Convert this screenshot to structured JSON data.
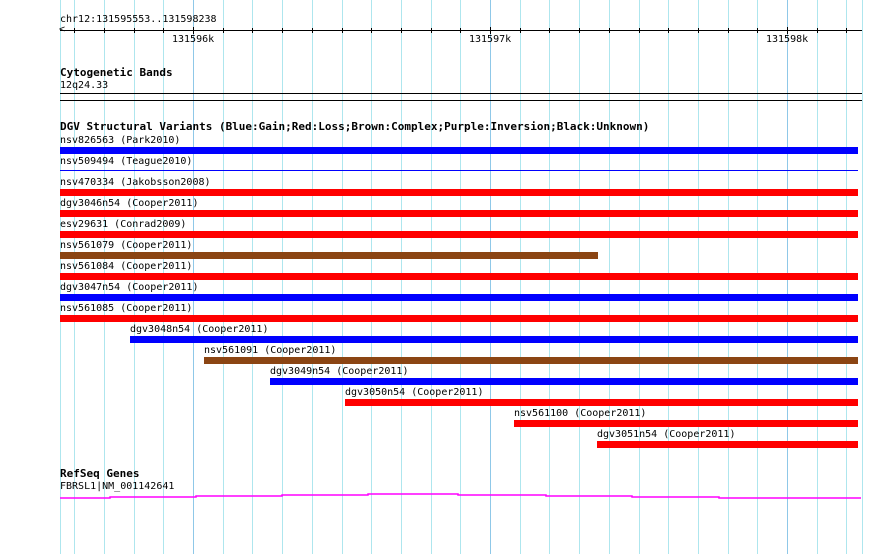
{
  "ruler": {
    "region": "chr12:131595553..131598238",
    "view_start": 131595553,
    "view_end": 131598238,
    "labels": [
      {
        "pos": 131596000,
        "text": "131596k"
      },
      {
        "pos": 131597000,
        "text": "131597k"
      },
      {
        "pos": 131598000,
        "text": "131598k"
      }
    ]
  },
  "cytobands": {
    "title": "Cytogenetic Bands",
    "band": "12q24.33"
  },
  "dgv": {
    "title": "DGV Structural Variants (Blue:Gain;Red:Loss;Brown:Complex;Purple:Inversion;Black:Unknown)",
    "colors": {
      "gain": "#0000ff",
      "loss": "#ff0000",
      "complex": "#8b4513"
    },
    "variants": [
      {
        "label": "nsv826563 (Park2010)",
        "start": 131595553,
        "end": 131598238,
        "type": "gain"
      },
      {
        "label": "nsv509494 (Teague2010)",
        "start": 131595553,
        "end": 131598238,
        "type": "gain",
        "thin": true
      },
      {
        "label": "nsv470334 (Jakobsson2008)",
        "start": 131595553,
        "end": 131598238,
        "type": "loss"
      },
      {
        "label": "dgv3046n54 (Cooper2011)",
        "start": 131595553,
        "end": 131598238,
        "type": "loss"
      },
      {
        "label": "esv29631 (Conrad2009)",
        "start": 131595553,
        "end": 131598238,
        "type": "loss"
      },
      {
        "label": "nsv561079 (Cooper2011)",
        "start": 131595553,
        "end": 131597364,
        "type": "complex"
      },
      {
        "label": "nsv561084 (Cooper2011)",
        "start": 131595553,
        "end": 131598238,
        "type": "loss"
      },
      {
        "label": "dgv3047n54 (Cooper2011)",
        "start": 131595553,
        "end": 131598238,
        "type": "gain"
      },
      {
        "label": "nsv561085 (Cooper2011)",
        "start": 131595553,
        "end": 131598238,
        "type": "loss"
      },
      {
        "label": "dgv3048n54 (Cooper2011)",
        "start": 131595788,
        "end": 131598238,
        "type": "gain"
      },
      {
        "label": "nsv561091 (Cooper2011)",
        "start": 131596037,
        "end": 131598238,
        "type": "complex"
      },
      {
        "label": "dgv3049n54 (Cooper2011)",
        "start": 131596259,
        "end": 131598238,
        "type": "gain"
      },
      {
        "label": "dgv3050n54 (Cooper2011)",
        "start": 131596512,
        "end": 131598238,
        "type": "loss"
      },
      {
        "label": "nsv561100 (Cooper2011)",
        "start": 131597081,
        "end": 131598238,
        "type": "loss"
      },
      {
        "label": "dgv3051n54 (Cooper2011)",
        "start": 131597360,
        "end": 131598238,
        "type": "loss"
      }
    ]
  },
  "refseq": {
    "title": "RefSeq Genes",
    "gene": "FBRSL1|NM_001142641",
    "color": "#ff00ff"
  }
}
